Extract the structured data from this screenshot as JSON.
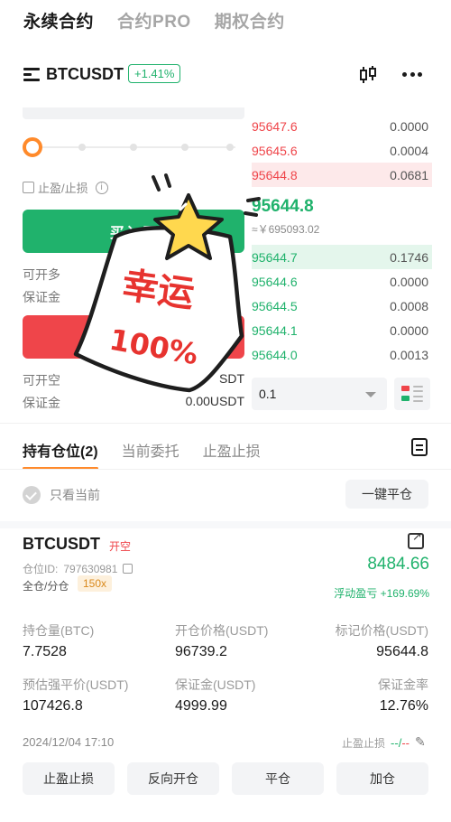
{
  "top_tabs": [
    "永续合约",
    "合约PRO",
    "期权合约"
  ],
  "header": {
    "pair": "BTCUSDT",
    "change": "+1.41%"
  },
  "order_form": {
    "tpsl_label": "止盈/止损",
    "buy_label": "买入/开",
    "sell_label": "",
    "open_long_label": "可开多",
    "margin_label": "保证金",
    "open_short_label": "可开空",
    "open_short_value": "SDT",
    "margin_value": "0.00USDT"
  },
  "order_book": {
    "asks": [
      {
        "price": "95647.6",
        "qty": "0.0000"
      },
      {
        "price": "95645.6",
        "qty": "0.0004"
      },
      {
        "price": "95644.8",
        "qty": "0.0681"
      }
    ],
    "last_price": "95644.8",
    "mark_price": "≈￥695093.02",
    "bids": [
      {
        "price": "95644.7",
        "qty": "0.1746"
      },
      {
        "price": "95644.6",
        "qty": "0.0000"
      },
      {
        "price": "95644.5",
        "qty": "0.0008"
      },
      {
        "price": "95644.1",
        "qty": "0.0000"
      },
      {
        "price": "95644.0",
        "qty": "0.0013"
      }
    ],
    "depth": "0.1"
  },
  "position_tabs": [
    "持有仓位(2)",
    "当前委托",
    "止盈止损"
  ],
  "filter": {
    "only_current": "只看当前",
    "close_all": "一键平仓"
  },
  "position": {
    "symbol": "BTCUSDT",
    "side": "开空",
    "id_label": "仓位ID:",
    "id_value": "797630981",
    "margin_mode": "全仓/分仓",
    "leverage": "150x",
    "pnl": "8484.66",
    "pnl_label": "浮动盈亏 +169.69%",
    "fields": [
      {
        "label": "持仓量(BTC)",
        "value": "7.7528"
      },
      {
        "label": "开仓价格(USDT)",
        "value": "96739.2"
      },
      {
        "label": "标记价格(USDT)",
        "value": "95644.8"
      },
      {
        "label": "预估强平价(USDT)",
        "value": "107426.8"
      },
      {
        "label": "保证金(USDT)",
        "value": "4999.99"
      },
      {
        "label": "保证金率",
        "value": "12.76%"
      }
    ],
    "time": "2024/12/04 17:10",
    "tpsl_label": "止盈止损",
    "tpsl_tp": "--",
    "tpsl_sep": "/",
    "tpsl_sl": "--"
  },
  "actions": [
    "止盈止损",
    "反向开仓",
    "平仓",
    "加仓"
  ],
  "sticker": {
    "text1": "幸运",
    "text2": "100%"
  },
  "colors": {
    "green": "#20b26c",
    "red": "#ef454a",
    "orange": "#ff8a2b"
  }
}
